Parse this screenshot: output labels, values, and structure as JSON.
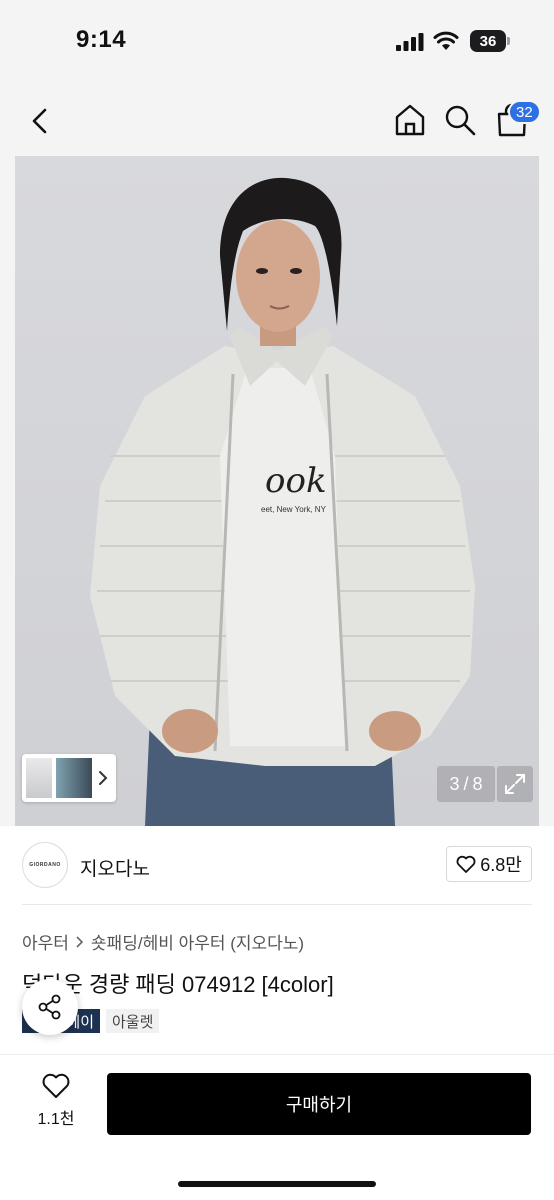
{
  "status_bar": {
    "time": "9:14",
    "battery": "36"
  },
  "nav": {
    "cart_count": "32"
  },
  "gallery": {
    "current": "3",
    "separator": "/",
    "total": "8"
  },
  "brand": {
    "name": "지오다노",
    "logo_text": "GIORDANO",
    "likes": "6.8만"
  },
  "product": {
    "category_1": "아우터",
    "category_2": "숏패딩/헤비 아우터 (지오다노)",
    "title": "덕다운 경량 패딩 074912 [4color]",
    "tags": [
      "헤이",
      "아울렛"
    ]
  },
  "bottom": {
    "wish_count": "1.1천",
    "buy_label": "구매하기"
  },
  "colors": {
    "buy": "#000000",
    "badge": "#2f6fe4",
    "tag_dark": "#1d3150"
  }
}
